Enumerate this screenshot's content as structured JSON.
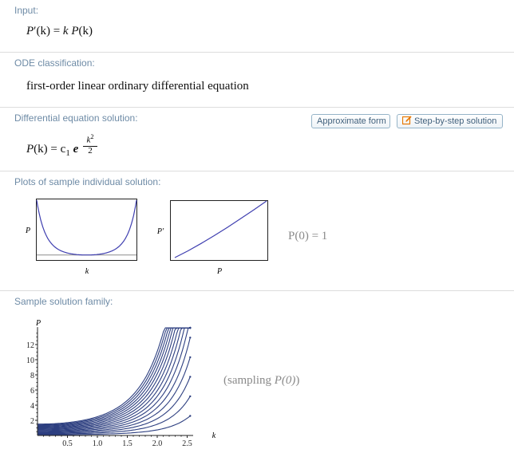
{
  "pods": {
    "input": {
      "title": "Input:",
      "lhs_fn": "P",
      "lhs_prime": "′",
      "lhs_arg": "(k)",
      "equals": "=",
      "rhs_k": "k",
      "rhs_fn": "P",
      "rhs_arg": "(k)"
    },
    "classification": {
      "title": "ODE classification:",
      "text": "first-order linear ordinary differential equation"
    },
    "solution": {
      "title": "Differential equation solution:",
      "approximate_button": "Approximate form",
      "step_button": "Step-by-step solution",
      "lhs_fn": "P",
      "lhs_arg": "(k)",
      "equals": "=",
      "const": "c",
      "const_sub": "1",
      "base": "e",
      "exp_num": "k",
      "exp_num_pow": "2",
      "exp_den": "2"
    },
    "plots": {
      "title": "Plots of sample individual solution:",
      "plot1_ylabel": "P",
      "plot1_xlabel": "k",
      "plot2_ylabel": "P′",
      "plot2_xlabel": "P",
      "initial_condition": "P(0) = 1"
    },
    "family": {
      "title": "Sample solution family:",
      "ylabel": "P",
      "xlabel": "k",
      "sampling_prefix": "(sampling ",
      "sampling_var": "P(0)",
      "sampling_suffix": ")"
    }
  },
  "chart_data": [
    {
      "type": "line",
      "series": [
        {
          "x": [
            -2.3,
            -1.5,
            -0.5,
            0,
            0.5,
            1.0,
            1.5,
            2.0,
            2.3
          ],
          "values": [
            0.071,
            0.325,
            0.882,
            1,
            1.133,
            1.649,
            3.08,
            7.389,
            14.08
          ]
        }
      ],
      "reference_line_y": 1,
      "xlabel": "k",
      "ylabel": "P"
    },
    {
      "type": "line",
      "series": [
        {
          "x": [
            0,
            2,
            4,
            6,
            8,
            10,
            12,
            14
          ],
          "values": [
            0,
            2.5,
            5.3,
            8.2,
            11.3,
            14.5,
            17.8,
            21.2
          ]
        }
      ],
      "xlabel": "P",
      "ylabel": "P′"
    },
    {
      "type": "line",
      "xlabel": "k",
      "ylabel": "P",
      "x_ticks": [
        "0.5",
        "1.0",
        "1.5",
        "2.0",
        "2.5"
      ],
      "y_ticks": [
        "2",
        "4",
        "6",
        "8",
        "10",
        "12"
      ],
      "xlim": [
        0,
        2.6
      ],
      "ylim": [
        0,
        14
      ],
      "initial_values": [
        0.1,
        0.2,
        0.3,
        0.4,
        0.5,
        0.6,
        0.7,
        0.8,
        0.9,
        1.0,
        1.1,
        1.2,
        1.3,
        1.4,
        1.5
      ],
      "model": "P(k) = P(0) e^(k^2/2)"
    }
  ],
  "colors": {
    "pod_title": "#6e8ba6",
    "curve": "#3f3fb0",
    "family_curve": "#2d3f80",
    "button_border": "#96b4c8",
    "button_text": "#40607c",
    "edit_icon": "#e67700"
  }
}
